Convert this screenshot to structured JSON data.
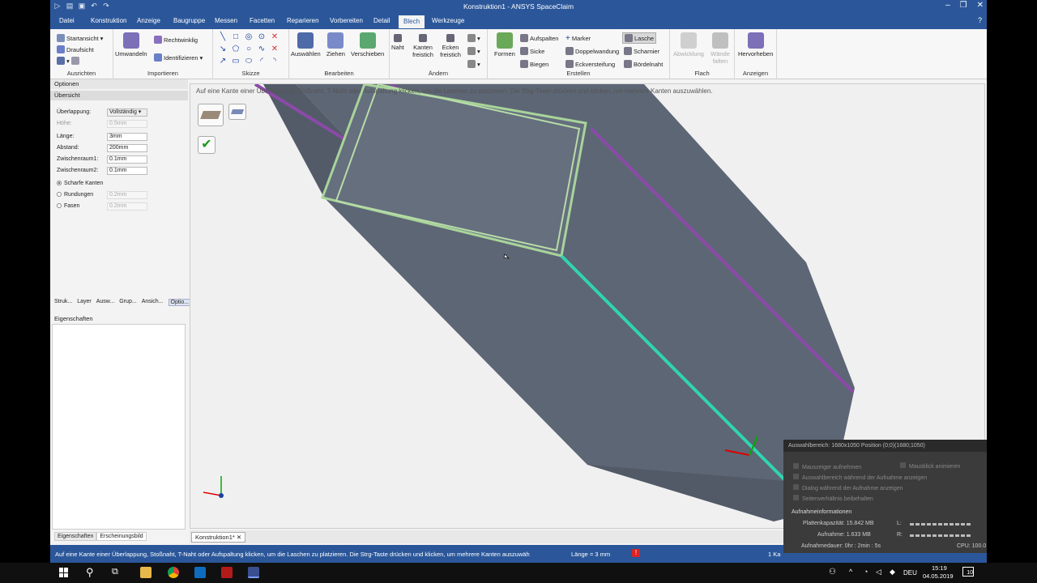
{
  "window": {
    "title": "Konstruktion1 - ANSYS SpaceClaim"
  },
  "tabs": [
    "Datei",
    "Konstruktion",
    "Anzeige",
    "Baugruppe",
    "Messen",
    "Facetten",
    "Reparieren",
    "Vorbereiten",
    "Detail",
    "Blech",
    "Werkzeuge"
  ],
  "active_tab": "Blech",
  "ribbon": {
    "ausrichten": {
      "label": "Ausrichten",
      "startansicht": "Startansicht",
      "draufsicht": "Draufsicht"
    },
    "importieren": {
      "label": "Importieren",
      "umwandeln": "Umwandeln",
      "rechtwinklig": "Rechtwinklig",
      "identifizieren": "Identifizieren"
    },
    "skizze": {
      "label": "Skizze"
    },
    "bearbeiten": {
      "label": "Bearbeiten",
      "auswaehlen": "Auswählen",
      "ziehen": "Ziehen",
      "verschieben": "Verschieben"
    },
    "aendern": {
      "label": "Ändern",
      "naht": "Naht",
      "kanten": "Kanten freistich",
      "ecken": "Ecken freistich"
    },
    "erstellen": {
      "label": "Erstellen",
      "formen": "Formen",
      "aufspalten": "Aufspalten",
      "sicke": "Sicke",
      "biegen": "Biegen",
      "marker": "Marker",
      "doppelwandung": "Doppelwandung",
      "eckversteifung": "Eckversteifung",
      "lasche": "Lasche",
      "scharnier": "Scharnier",
      "boerdelnaht": "Bördelnaht"
    },
    "flach": {
      "label": "Flach",
      "abwicklung": "Abwicklung",
      "waende": "Wände falten"
    },
    "anzeigen": {
      "label": "Anzeigen",
      "hervorheben": "Hervorheben"
    }
  },
  "left_panel": {
    "optionen": "Optionen",
    "uebersicht": "Übersicht",
    "fields": [
      {
        "label": "Überlappung:",
        "value": "Vollständig",
        "disabled": false
      },
      {
        "label": "Höhe:",
        "value": "0.5mm",
        "disabled": true
      },
      {
        "label": "Länge:",
        "value": "3mm",
        "disabled": false
      },
      {
        "label": "Abstand:",
        "value": "200mm",
        "disabled": false
      },
      {
        "label": "Zwischenraum1:",
        "value": "0.1mm",
        "disabled": false
      },
      {
        "label": "Zwischenraum2:",
        "value": "0.1mm",
        "disabled": false
      }
    ],
    "radios": [
      {
        "label": "Scharfe Kanten",
        "value": "",
        "checked": true
      },
      {
        "label": "Rundungen",
        "value": "0.2mm",
        "checked": false
      },
      {
        "label": "Fasen",
        "value": "0.2mm",
        "checked": false
      }
    ],
    "panel_tabs": [
      "Struk...",
      "Layer",
      "Ausw...",
      "Grup...",
      "Ansich...",
      "Optio..."
    ],
    "eigenschaften": "Eigenschaften",
    "bottom_tabs": [
      "Eigenschaften",
      "Erscheinungsbild"
    ]
  },
  "viewport": {
    "hint": "Auf eine Kante einer Überlappung, Stoßnaht, T-Naht oder Aufspaltung klicken, um die Laschen zu platzieren.  Die Strg-Taste drücken und klicken, um mehrere Kanten auszuwählen.",
    "doc_tab": "Konstruktion1*"
  },
  "statusbar": {
    "message": "Auf eine Kante einer Überlappung, Stoßnaht, T-Naht oder Aufspaltung klicken, um die Laschen zu platzieren.  Die Strg-Taste drücken und klicken, um mehrere Kanten auszuwäh",
    "laenge": "Länge = 3 mm",
    "count": "1 Ka"
  },
  "recording": {
    "header": "Auswahlbereich: 1680x1050 Position (0;0)(1680;1050)",
    "options": [
      "Mauszeiger aufnehmen",
      "Auswahlbereich während der Aufnahme anzeigen",
      "Dialog während der Aufnahme anzeigen",
      "Seitenverhältnis beibehalten"
    ],
    "option_right": "Mausklick animieren",
    "info_title": "Aufnahmeinformationen",
    "kapazitaet": "Plattenkapazität: 15.842 MB",
    "aufnahme": "Aufnahme: 1.633 MB",
    "dauer": "Aufnahmedauer: 0hr : 2min : 5s",
    "l": "L:",
    "r": "R:",
    "cpu": "CPU: 100.0"
  },
  "taskbar": {
    "lang": "DEU",
    "time": "15:19",
    "date": "04.05.2019",
    "notif": "10"
  },
  "colors": {
    "accent": "#2b579a",
    "part": "#5d6675",
    "edge_purple": "#8b4aa8",
    "edge_green": "#a8d49a",
    "edge_cyan": "#2fd5b0"
  }
}
